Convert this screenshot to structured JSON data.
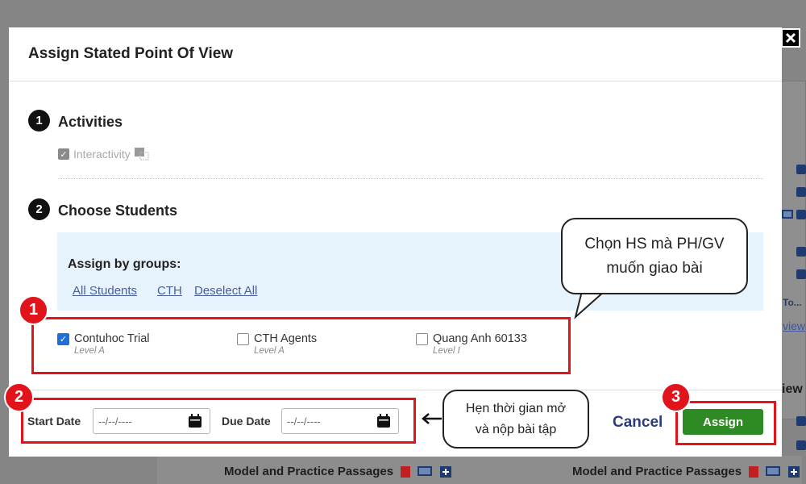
{
  "modal": {
    "title": "Assign Stated Point Of View",
    "close_icon": "close-icon"
  },
  "steps": [
    {
      "number": "1",
      "title": "Activities"
    },
    {
      "number": "2",
      "title": "Choose Students"
    }
  ],
  "activities": {
    "items": [
      {
        "label": "Interactivity",
        "checked": true,
        "icon": "interactivity-icon"
      }
    ]
  },
  "groups": {
    "label": "Assign by groups:",
    "links": [
      "All Students",
      "CTH",
      "Deselect All"
    ]
  },
  "students": [
    {
      "name": "Contuhoc Trial",
      "level": "Level A",
      "checked": true
    },
    {
      "name": "CTH Agents",
      "level": "Level A",
      "checked": false
    },
    {
      "name": "Quang Anh 60133",
      "level": "Level I",
      "checked": false
    }
  ],
  "dates": {
    "start_label": "Start Date",
    "start_placeholder": "--/--/----",
    "due_label": "Due Date",
    "due_placeholder": "--/--/----"
  },
  "actions": {
    "cancel_label": "Cancel",
    "assign_label": "Assign"
  },
  "annotations": {
    "badges": [
      "1",
      "2",
      "3"
    ],
    "bubble_students": [
      "Chọn HS mà PH/GV",
      "muốn giao bài"
    ],
    "bubble_dates": [
      "Hẹn thời gian mở",
      "và nộp bài tập"
    ],
    "highlight_color": "#e0141a"
  },
  "background": {
    "passage_title_left": "Model and Practice Passages",
    "passage_title_right": "Model and Practice Passages",
    "right_edge_texts": [
      "To...",
      "view",
      "iew"
    ]
  },
  "colors": {
    "assign_button": "#2e8b24",
    "cancel_text": "#2b3d78",
    "groups_bg": "#e6f2fc",
    "checkbox_checked": "#1e6fd9"
  }
}
